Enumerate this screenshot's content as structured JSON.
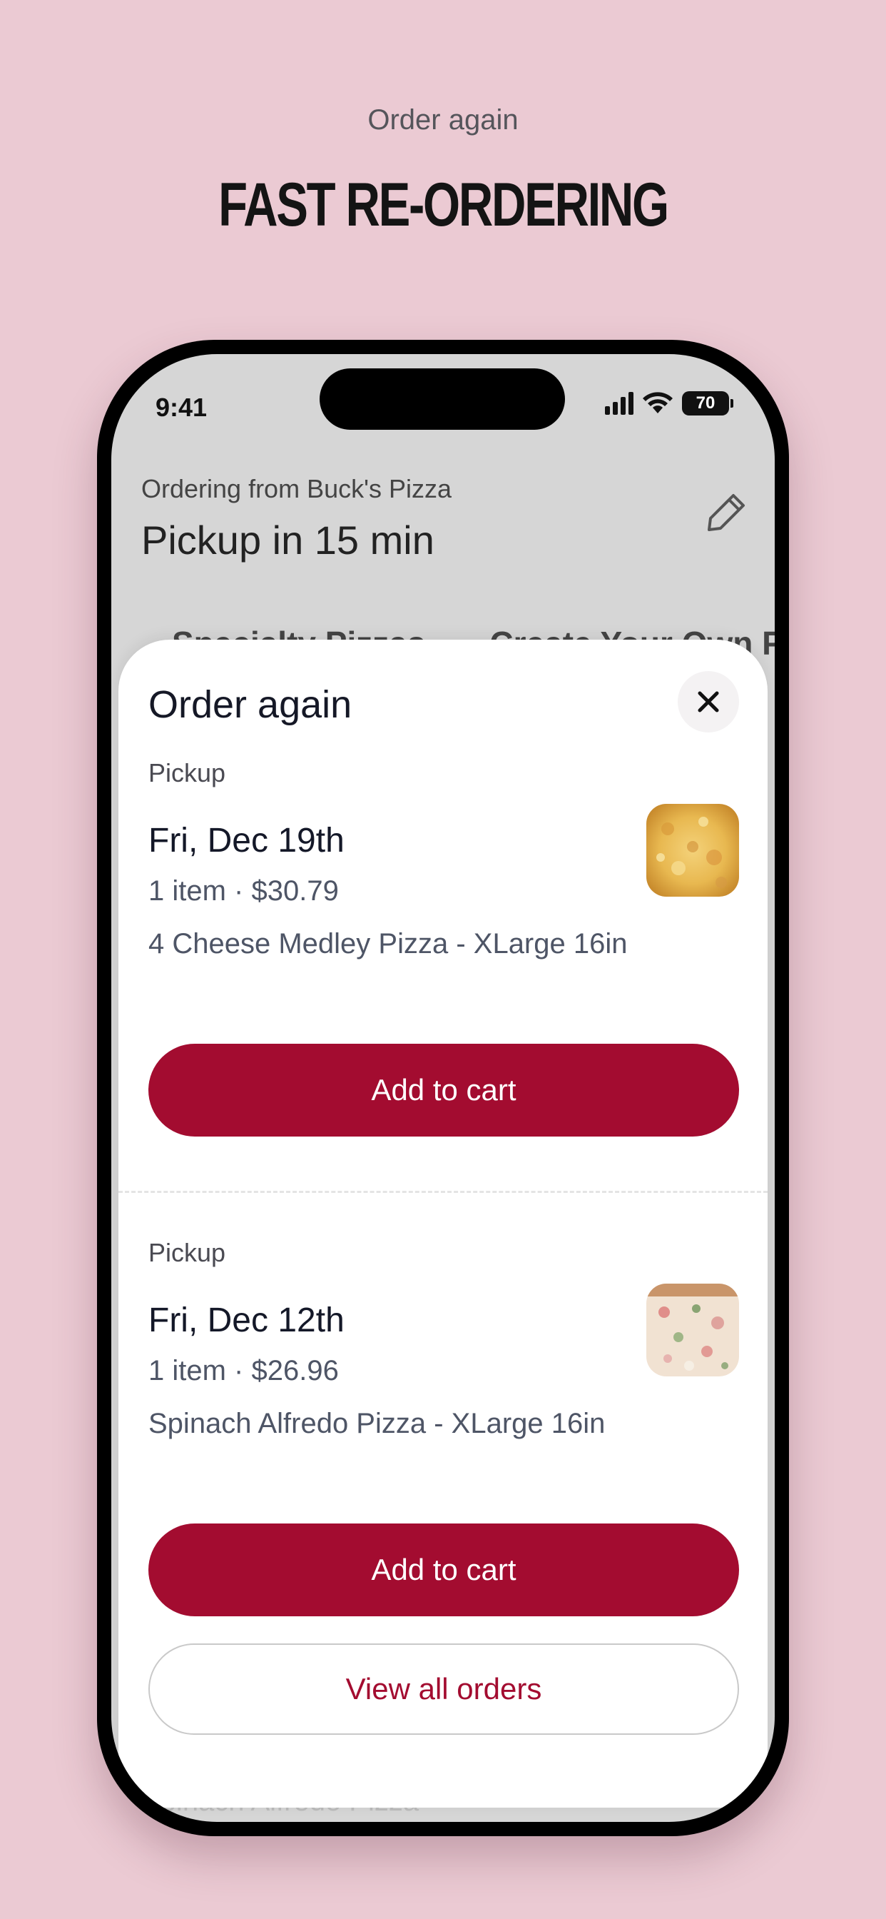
{
  "promo": {
    "eyebrow": "Order again",
    "title": "FAST RE-ORDERING"
  },
  "status_bar": {
    "time": "9:41",
    "battery": "70"
  },
  "background_screen": {
    "ordering_from": "Ordering from Buck's Pizza",
    "pickup_time": "Pickup in 15 min",
    "tabs": [
      "Specialty Pizzas",
      "Create Your Own Pizza"
    ],
    "bottom_text": "Spinach Alfredo Pizza"
  },
  "sheet": {
    "title": "Order again",
    "orders": [
      {
        "type": "Pickup",
        "date": "Fri, Dec 19th",
        "summary": "1 item · $30.79",
        "item": "4 Cheese Medley Pizza - XLarge 16in",
        "thumb_icon": "cheese-pizza-photo",
        "button": "Add to cart"
      },
      {
        "type": "Pickup",
        "date": "Fri, Dec 12th",
        "summary": "1 item · $26.96",
        "item": "Spinach Alfredo Pizza - XLarge 16in",
        "thumb_icon": "spinach-alfredo-pizza-photo",
        "button": "Add to cart"
      }
    ],
    "view_all": "View all orders"
  },
  "colors": {
    "background": "#ebcad3",
    "accent": "#a30c30"
  }
}
